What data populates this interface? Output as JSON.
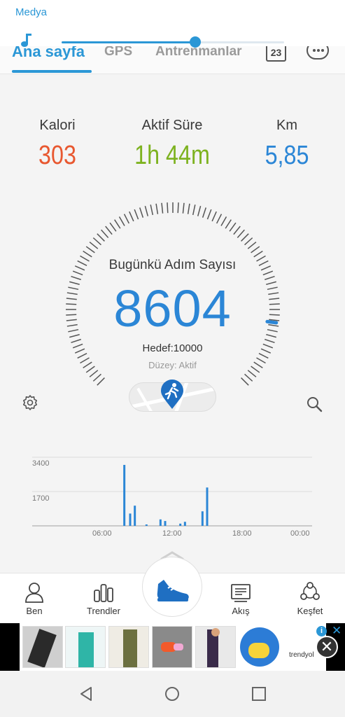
{
  "media": {
    "title": "Medya",
    "progress": 0.6
  },
  "tabs": [
    {
      "label": "Ana sayfa",
      "active": true
    },
    {
      "label": "GPS",
      "active": false
    },
    {
      "label": "Antrenmanlar",
      "active": false
    }
  ],
  "calendar_day": "23",
  "stats": [
    {
      "label": "Kalori",
      "value": "303",
      "color": "#e8572f"
    },
    {
      "label": "Aktif Süre",
      "value": "1h 44m",
      "color": "#7db21f"
    },
    {
      "label": "Km",
      "value": "5,85",
      "color": "#2b86d6"
    }
  ],
  "gauge": {
    "title": "Bugünkü Adım Sayısı",
    "steps": "8604",
    "goal": "Hedef:10000",
    "level": "Düzey: Aktif",
    "goal_value": 10000,
    "steps_value": 8604
  },
  "chart_data": {
    "type": "bar",
    "y_ticks": [
      "3400",
      "1700"
    ],
    "x_ticks": [
      "06:00",
      "12:00",
      "18:00",
      "00:00"
    ],
    "ylim": [
      0,
      3400
    ],
    "bars": [
      {
        "hour": 7.9,
        "value": 3020
      },
      {
        "hour": 8.4,
        "value": 610
      },
      {
        "hour": 8.8,
        "value": 1000
      },
      {
        "hour": 9.8,
        "value": 70
      },
      {
        "hour": 11.0,
        "value": 320
      },
      {
        "hour": 11.4,
        "value": 240
      },
      {
        "hour": 12.7,
        "value": 110
      },
      {
        "hour": 13.1,
        "value": 200
      },
      {
        "hour": 14.6,
        "value": 720
      },
      {
        "hour": 15.0,
        "value": 1900
      }
    ]
  },
  "bottom_nav": [
    {
      "label": "Ben",
      "icon": "person-icon"
    },
    {
      "label": "Trendler",
      "icon": "bar-chart-icon"
    },
    {
      "label": "Akış",
      "icon": "feed-icon"
    },
    {
      "label": "Keşfet",
      "icon": "explore-icon"
    }
  ],
  "ad": {
    "brand": "trendyol",
    "info": "i",
    "close": "✕",
    "close_button": "✕"
  }
}
